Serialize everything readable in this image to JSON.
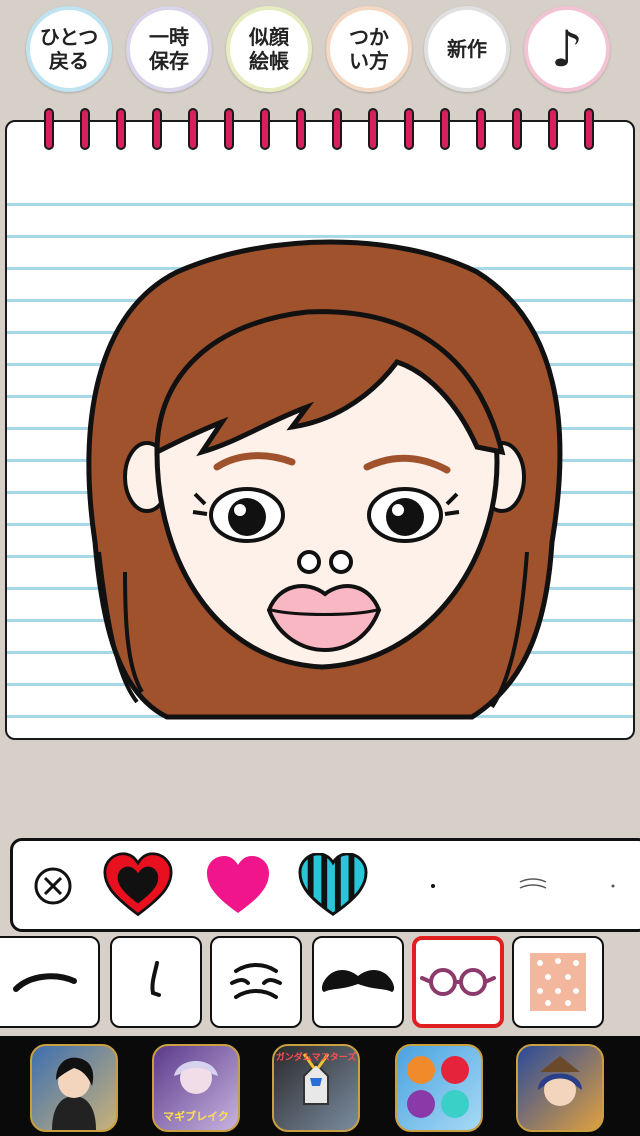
{
  "toolbar": {
    "undo_label": "ひとつ\n戻る",
    "save_label": "一時\n保存",
    "gallery_label": "似顔\n絵帳",
    "help_label": "つか\nい方",
    "new_label": "新作",
    "music_label": "♪"
  },
  "toolbar_ring_colors": [
    "#bfe3f0",
    "#d9d4ea",
    "#e6ecc0",
    "#f4d8c4",
    "#e0e0e0",
    "#f2c3d3"
  ],
  "canvas": {
    "paper_color": "#ffffff",
    "line_color": "#a8d7ea",
    "ring_color": "#d6215d",
    "hair_color": "#a0522d",
    "skin_color": "#fdf1ea",
    "lip_color": "#f9b7c4"
  },
  "palette": {
    "items": [
      {
        "name": "clear",
        "icon": "circle-x-icon"
      },
      {
        "name": "red-heart",
        "icon": "heart-icon",
        "color": "#e8101e"
      },
      {
        "name": "pink-heart",
        "icon": "heart-icon",
        "color": "#f0158a"
      },
      {
        "name": "striped-heart",
        "icon": "heart-icon",
        "color": "#27c6d8"
      },
      {
        "name": "dot",
        "icon": "dot-icon"
      },
      {
        "name": "small-lines",
        "icon": "lines-icon"
      },
      {
        "name": "tiny-dot",
        "icon": "dot-icon"
      }
    ]
  },
  "categories": {
    "items": [
      {
        "name": "eyebrows",
        "icon": "eyebrow-icon"
      },
      {
        "name": "nose",
        "icon": "nose-icon"
      },
      {
        "name": "wrinkles",
        "icon": "wrinkle-icon"
      },
      {
        "name": "mustache",
        "icon": "mustache-icon"
      },
      {
        "name": "glasses",
        "icon": "glasses-icon",
        "selected": true
      },
      {
        "name": "cheeks",
        "icon": "blush-icon"
      }
    ]
  },
  "ads": {
    "items": [
      {
        "name": "anime-hero",
        "label": ""
      },
      {
        "name": "magic-break",
        "label": "マギブレイク"
      },
      {
        "name": "gundam-masters",
        "label": "ガンダムマスターズ"
      },
      {
        "name": "fruit-puzzle",
        "label": ""
      },
      {
        "name": "fantasy-rpg",
        "label": ""
      }
    ]
  }
}
